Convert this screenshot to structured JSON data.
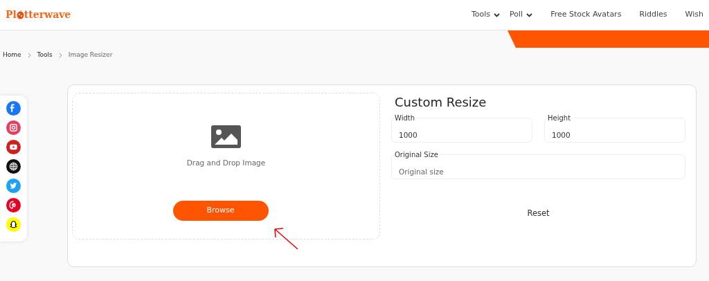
{
  "header": {
    "logo_start": "Pl",
    "logo_end": "tterwave",
    "nav": [
      {
        "label": "Tools",
        "dropdown": true
      },
      {
        "label": "Poll",
        "dropdown": true
      },
      {
        "label": "Free Stock Avatars",
        "dropdown": false
      },
      {
        "label": "Riddles",
        "dropdown": false
      },
      {
        "label": "Wish",
        "dropdown": false
      }
    ]
  },
  "breadcrumb": [
    {
      "label": "Home",
      "current": false
    },
    {
      "label": "Tools",
      "current": false
    },
    {
      "label": "Image Resizer",
      "current": true
    }
  ],
  "social": [
    {
      "kind": "facebook",
      "color": "#1877f2"
    },
    {
      "kind": "instagram",
      "color": "#e4405f"
    },
    {
      "kind": "youtube",
      "color": "#cd201f"
    },
    {
      "kind": "website",
      "color": "#111111"
    },
    {
      "kind": "twitter",
      "color": "#1da1f2"
    },
    {
      "kind": "pinterest",
      "color": "#e60023"
    },
    {
      "kind": "snapchat",
      "color": "#fffc00"
    }
  ],
  "dropzone": {
    "text": "Drag and Drop Image",
    "button": "Browse"
  },
  "resize": {
    "title": "Custom Resize",
    "fields": [
      {
        "label": "Width",
        "value": "1000"
      },
      {
        "label": "Height",
        "value": "1000"
      },
      {
        "label": "Original Size",
        "placeholder": "Original size"
      }
    ],
    "reset": "Reset"
  }
}
